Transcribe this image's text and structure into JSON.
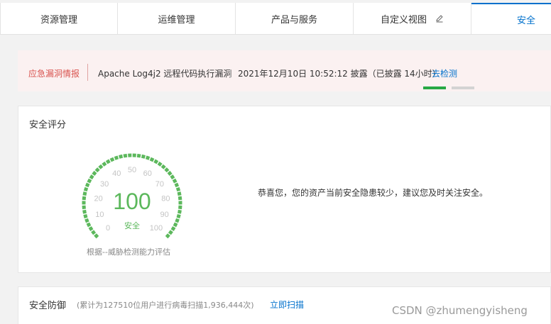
{
  "tabs": [
    {
      "label": "资源管理"
    },
    {
      "label": "运维管理"
    },
    {
      "label": "产品与服务"
    },
    {
      "label": "自定义视图",
      "icon": "edit-icon"
    },
    {
      "label": "安全",
      "active": true
    }
  ],
  "alert": {
    "tag": "应急漏洞情报",
    "title": "Apache Log4j2 远程代码执行漏洞",
    "time": "2021年12月10日 10:52:12 披露（已披露 14小时）",
    "link": "去检测"
  },
  "score": {
    "title": "安全评分",
    "value": "100",
    "status": "安全",
    "ticks": [
      "0",
      "10",
      "20",
      "30",
      "40",
      "50",
      "60",
      "70",
      "80",
      "90",
      "100"
    ],
    "note": "根据--威胁检测能力评估",
    "message": "恭喜您，您的资产当前安全隐患较少，建议您及时关注安全。",
    "color": "#5cb85c"
  },
  "defense": {
    "title": "安全防御",
    "subtitle": "(累计为127510位用户进行病毒扫描1,936,444次)",
    "scan_label": "立即扫描"
  },
  "watermark": "CSDN @zhumengyisheng",
  "colors": {
    "accent": "#0070cc",
    "danger": "#d9534f",
    "safe": "#5cb85c"
  }
}
